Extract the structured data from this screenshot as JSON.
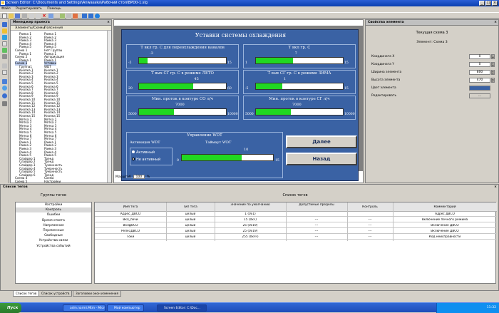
{
  "window": {
    "title": "Screen Editor: C:\\Documents and Settings\\Anwasaka\\Рабочий стол\\BPD0-1.slg"
  },
  "menu": [
    "Файл",
    "Редактировать",
    "Помощь"
  ],
  "project": {
    "title": "Менеджер проекта",
    "col_name": "Элементы/Схемы",
    "col_comment": "Пояснения",
    "rows": [
      {
        "n": "Рамка 1",
        "c": "Рамка 1"
      },
      {
        "n": "Рамка 2",
        "c": "Рамка 2"
      },
      {
        "n": "Рамка 3",
        "c": "Рамка 3"
      },
      {
        "n": "Рамка 4",
        "c": "Рамка 4"
      },
      {
        "n": "Рамка 5",
        "c": "Рамка 5"
      },
      {
        "n": "Схема 1",
        "c": "Нет Группы"
      },
      {
        "n": "Рамка 1",
        "c": "Рамка 1"
      },
      {
        "n": "Схема 2",
        "c": "Авторизация"
      },
      {
        "n": "Рамка 1",
        "c": "Рамка 1"
      },
      {
        "n": "Схема 3",
        "c": "Уставки"
      },
      {
        "n": "Группа1",
        "c": "WDT"
      },
      {
        "n": "Кнопка 1",
        "c": "Кнопка 1"
      },
      {
        "n": "Кнопка 2",
        "c": "Кнопка 2"
      },
      {
        "n": "Кнопка 3",
        "c": "Кнопка 3"
      },
      {
        "n": "Кнопка 4",
        "c": "Кнопка 4"
      },
      {
        "n": "Кнопка 5",
        "c": "Кнопка 5"
      },
      {
        "n": "Кнопка 6",
        "c": "Кнопка 6"
      },
      {
        "n": "Кнопка 7",
        "c": "Кнопка 7"
      },
      {
        "n": "Кнопка 8",
        "c": "Кнопка 8"
      },
      {
        "n": "Кнопка 9",
        "c": "Кнопка 9"
      },
      {
        "n": "Кнопка 10",
        "c": "Кнопка 10"
      },
      {
        "n": "Кнопка 11",
        "c": "Кнопка 11"
      },
      {
        "n": "Кнопка 12",
        "c": "Кнопка 12"
      },
      {
        "n": "Кнопка 13",
        "c": "Кнопка 13"
      },
      {
        "n": "Кнопка 14",
        "c": "Кнопка 14"
      },
      {
        "n": "Кнопка 15",
        "c": "Кнопка 15"
      },
      {
        "n": "Метка 1",
        "c": "Метка 1"
      },
      {
        "n": "Метка 2",
        "c": "Метка 2"
      },
      {
        "n": "Метка 3",
        "c": "Метка 3"
      },
      {
        "n": "Метка 4",
        "c": "Метка 4"
      },
      {
        "n": "Метка 5",
        "c": "Метка 5"
      },
      {
        "n": "Метка 6",
        "c": "Метка 6"
      },
      {
        "n": "Метка 7",
        "c": "Метка 7"
      },
      {
        "n": "Рамка 1",
        "c": "Рамка 1"
      },
      {
        "n": "Рамка 2",
        "c": "Рамка 2"
      },
      {
        "n": "Рамка 3",
        "c": "Рамка 3"
      },
      {
        "n": "Рамка 4",
        "c": "Рамка 4"
      },
      {
        "n": "Рамка 5",
        "c": "Рамка 5"
      },
      {
        "n": "Слайдер 1",
        "c": "Тренд"
      },
      {
        "n": "Слайдер 2",
        "c": "Тренд"
      },
      {
        "n": "Слайдер 3",
        "c": "Туманность"
      },
      {
        "n": "Слайдер 4",
        "c": "Туманность"
      },
      {
        "n": "Слайдер 5",
        "c": "Туманность"
      },
      {
        "n": "Слайдер 6",
        "c": "Тренд"
      },
      {
        "n": "Схема 4",
        "c": "Схема"
      },
      {
        "n": "Схема 5",
        "c": "Настройки"
      }
    ]
  },
  "scada": {
    "title": "Уставки системы охлаждения",
    "gauges": [
      {
        "label": "Т вкл гр. С для переохлаждения каналов",
        "min": "-5",
        "max": "15",
        "value": "-3",
        "frac": 0.1
      },
      {
        "label": "Т вкл гр. С",
        "min": "1",
        "max": "15",
        "value": "7",
        "frac": 0.43
      },
      {
        "label": "Т вых СГ гр. С в режиме ЛЕТО",
        "min": "20",
        "max": "60",
        "value": "45",
        "frac": 0.62
      },
      {
        "label": "Т вых СГ гр. С в режиме ЗИМА",
        "min": "-5",
        "max": "15",
        "value": "1",
        "frac": 0.3
      },
      {
        "label": "Мин. проток в контуре СО л/ч",
        "min": "5000",
        "max": "10000",
        "value": "7000",
        "frac": 0.4
      },
      {
        "label": "Мин. проток в контуре СГ л/ч",
        "min": "5000",
        "max": "10000",
        "value": "7000",
        "frac": 0.4
      }
    ],
    "wdt": {
      "title": "Управление WDT",
      "activation": "Активация WDT",
      "timeout": "Таймаут WDT",
      "opt_active": "Активный",
      "opt_inactive": "Не активный",
      "min": "0",
      "max": "15",
      "value": "10",
      "frac": 0.66
    },
    "next": "Далее",
    "back": "Назад"
  },
  "zoom": {
    "label": "Масштаб",
    "value": "100",
    "unit": "%"
  },
  "props": {
    "title": "Свойства элемента",
    "current": "Текущая схема 3",
    "element": "Элемент: Схема 3",
    "rows": [
      {
        "label": "Координата X",
        "value": "0"
      },
      {
        "label": "Координата Y",
        "value": "0"
      },
      {
        "label": "Ширина элемента",
        "value": "800"
      },
      {
        "label": "Высота элемента",
        "value": "470"
      },
      {
        "label": "Цвет элемента",
        "value": ""
      },
      {
        "label": "Редактировать",
        "value": "..."
      }
    ]
  },
  "tags": {
    "title": "Список тегов",
    "groups_title": "Группы тегов",
    "taglist_title": "Список тегов",
    "groups": [
      "Настройки",
      "Контроль",
      "Ошибки",
      "Время ответа",
      "Напряжение",
      "Переменные",
      "Свободные",
      "Устройства связи",
      "Устройства событий"
    ],
    "columns": [
      "Имя тега",
      "Тип тега",
      "Значение по умолчанию",
      "Допустимые пределы",
      "Контроль",
      "Комментарий"
    ],
    "rows": [
      {
        "name": "Адрес_ДВСО",
        "type": "целый",
        "def": "1 (0x1)",
        "lim": "",
        "ctl": "",
        "com": "Адрес ДВСО"
      },
      {
        "name": "Вкл_печи",
        "type": "целый",
        "def": "15 (0xF)",
        "lim": "---",
        "ctl": "---",
        "com": "Включение печного режима"
      },
      {
        "name": "ВклДВСО",
        "type": "целый",
        "def": "25 (0x19)",
        "lim": "---",
        "ctl": "---",
        "com": "Включение ДВСО"
      },
      {
        "name": "Реле1ДВСО",
        "type": "целый",
        "def": "25 (0x19)",
        "lim": "---",
        "ctl": "---",
        "com": "Включение ДВСО"
      },
      {
        "name": "Токи",
        "type": "целый",
        "def": "255 (0xFF)",
        "lim": "---",
        "ctl": "---",
        "com": "Код неисправности"
      }
    ]
  },
  "bottom_tabs": [
    "Список тегов",
    "Список устройств",
    "Заголовки окон изменения"
  ],
  "taskbar": {
    "start": "Пуск",
    "tasks": [
      "Сообщения",
      "adm.narmi.Mtm - Microsoft ...",
      "Мой компьютер",
      "Screen Editor: C:\\Doc..."
    ],
    "clock": "11:32"
  },
  "colors": {
    "scada_bg": "#3a62a4",
    "gauge_fill": "#21d721"
  }
}
